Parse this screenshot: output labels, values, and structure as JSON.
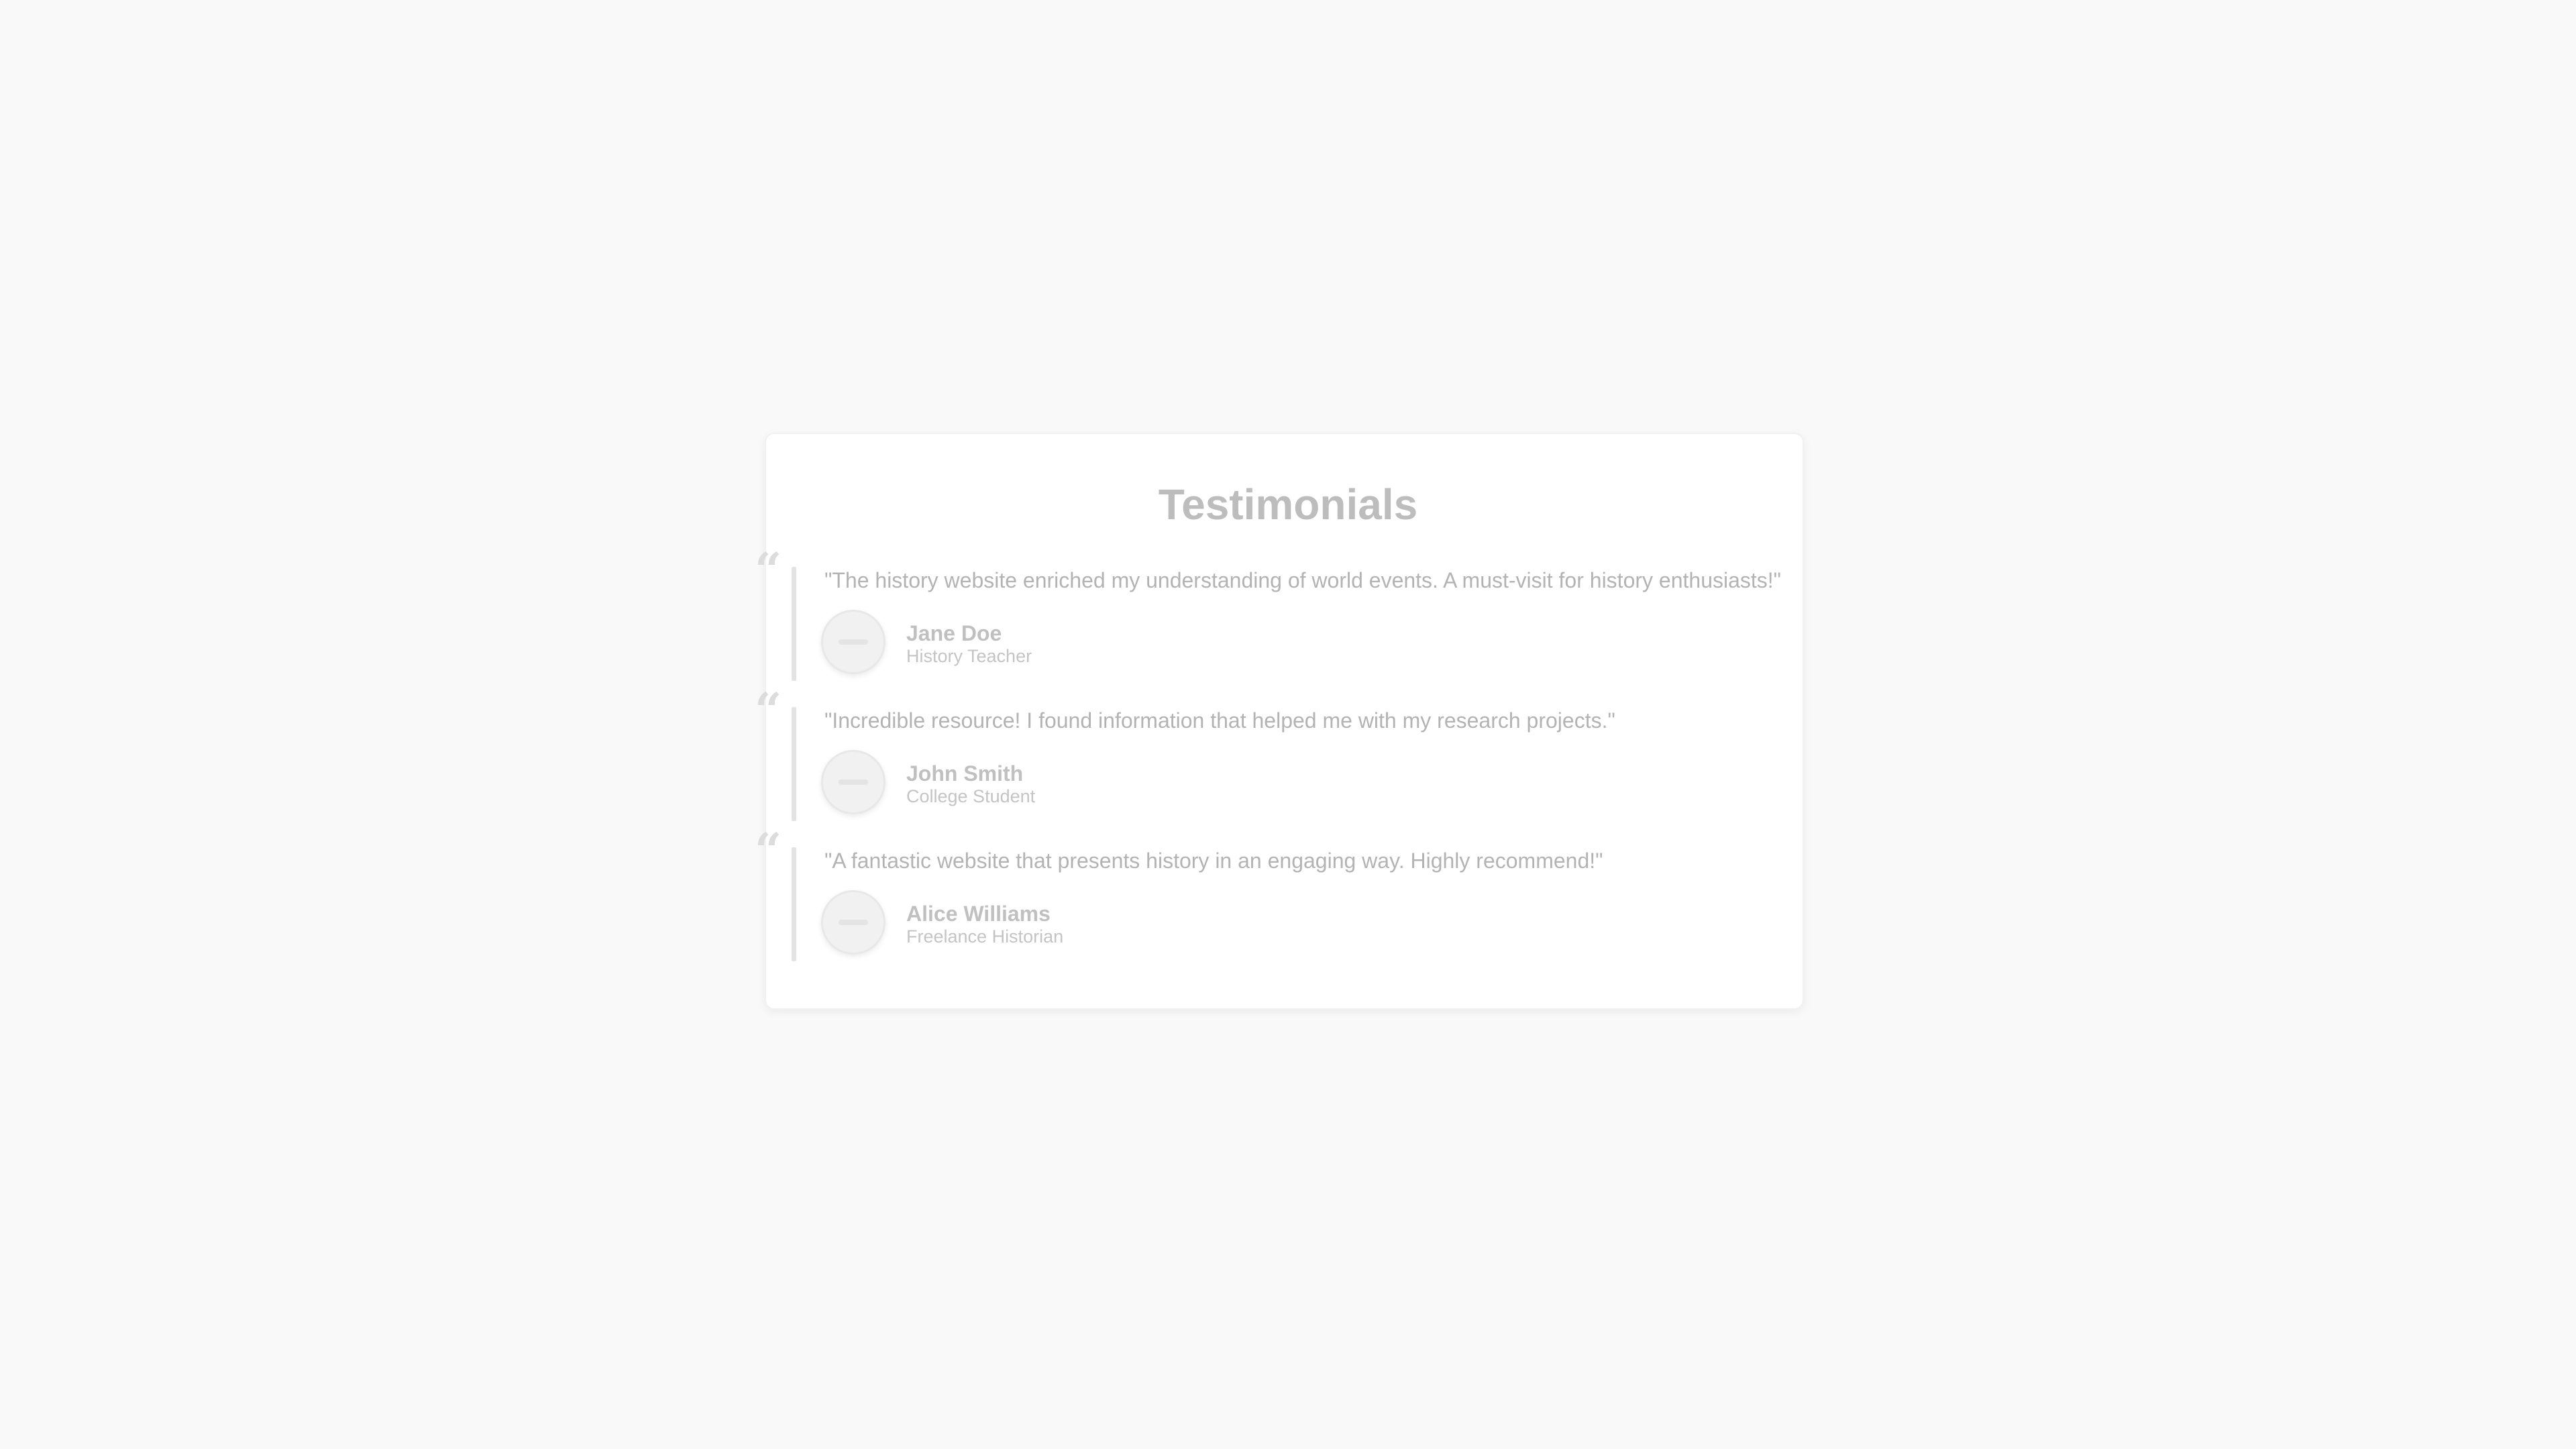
{
  "page": {
    "background": "#f9f9f9",
    "title": "Testimonials"
  },
  "testimonials": [
    {
      "quote": "\"The history website enriched my understanding of world events. A must-visit for history enthusiasts!\"",
      "name": "Jane Doe",
      "role": "History Teacher"
    },
    {
      "quote": "\"Incredible resource! I found information that helped me with my research projects.\"",
      "name": "John Smith",
      "role": "College Student"
    },
    {
      "quote": "\"A fantastic website that presents history in an engaging way. Highly recommend!\"",
      "name": "Alice Williams",
      "role": "Freelance Historian"
    }
  ],
  "icons": {
    "quote_mark": "“",
    "avatar": "avatar-placeholder-icon"
  },
  "colors": {
    "card": "#ffffff",
    "title": "#bdbdbd",
    "text": "#b3b3b3",
    "accent_bar": "#e3e3e3"
  }
}
